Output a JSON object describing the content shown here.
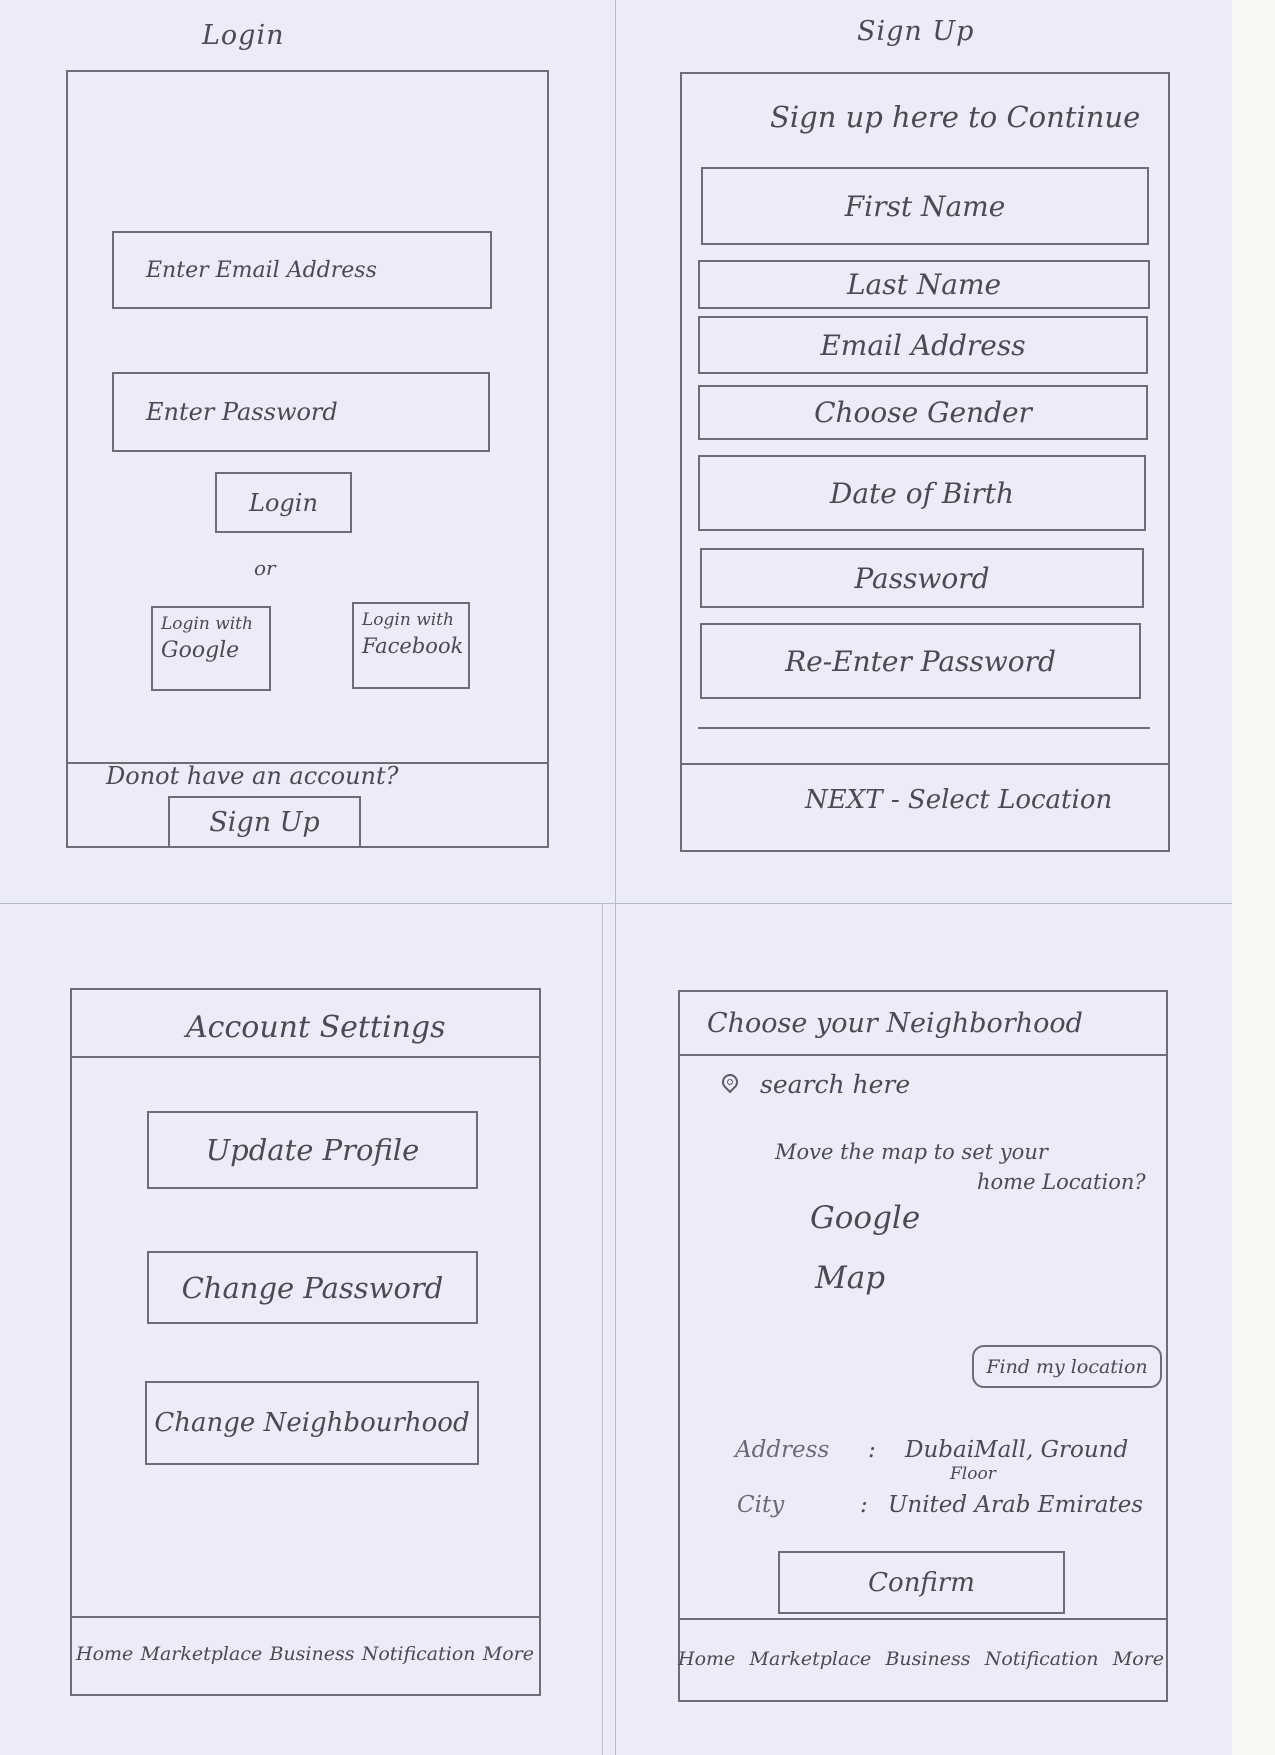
{
  "login": {
    "title": "Login",
    "email_placeholder": "Enter Email Address",
    "password_placeholder": "Enter Password",
    "login_button": "Login",
    "or": "or",
    "google_line1": "Login with",
    "google_line2": "Google",
    "facebook_line1": "Login with",
    "facebook_line2": "Facebook",
    "no_account": "Donot have an account?",
    "signup_button": "Sign Up"
  },
  "signup": {
    "title": "Sign Up",
    "subtitle": "Sign up here to Continue",
    "fields": [
      "First Name",
      "Last Name",
      "Email Address",
      "Choose Gender",
      "Date of Birth",
      "Password",
      "Re-Enter Password"
    ],
    "next": "NEXT - Select Location"
  },
  "account": {
    "title": "Account Settings",
    "buttons": [
      "Update Profile",
      "Change Password",
      "Change Neighbourhood"
    ]
  },
  "neighborhood": {
    "title": "Choose your Neighborhood",
    "search": "search here",
    "hint_line1": "Move the map to set your",
    "hint_line2": "home Location?",
    "map_line1": "Google",
    "map_line2": "Map",
    "find_location": "Find my location",
    "address_label": "Address",
    "address_value_line1": "DubaiMall, Ground",
    "address_value_line2": "Floor",
    "city_label": "City",
    "city_value": "United Arab Emirates",
    "confirm": "Confirm"
  },
  "nav": [
    "Home",
    "Marketplace",
    "Business",
    "Notification",
    "More"
  ]
}
